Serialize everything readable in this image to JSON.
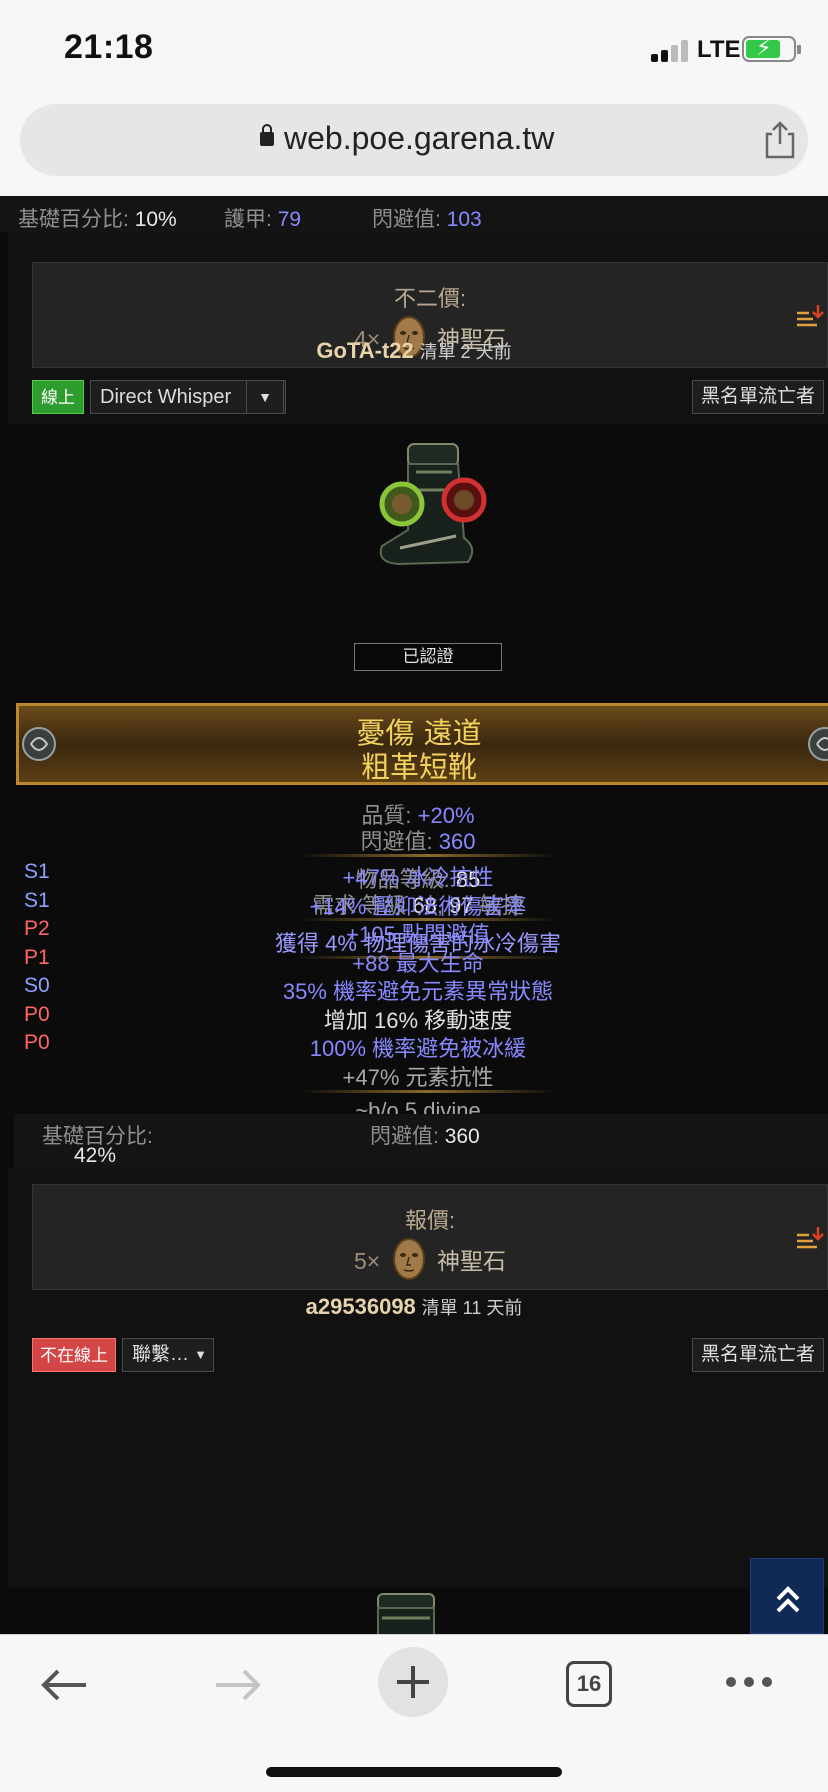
{
  "status_bar": {
    "time": "21:18",
    "network": "LTE",
    "battery_color": "#33c84a"
  },
  "browser": {
    "url": "web.poe.garena.tw",
    "tabs_count": "16"
  },
  "top_row": {
    "base_pct_label": "基礎百分比:",
    "base_pct_value": "10%",
    "armour_label": "護甲:",
    "armour_value": "79",
    "evasion_label": "閃避值:",
    "evasion_value": "103"
  },
  "listing1": {
    "price_label": "不二價:",
    "price_qty": "4×",
    "price_currency": "神聖石",
    "seller": "GoTA-t22",
    "listed": "清單 2 天前",
    "status": "線上",
    "whisper": "Direct Whisper",
    "blacklist": "黑名單流亡者"
  },
  "item": {
    "verified": "已認證",
    "name": "憂傷 遠道",
    "base": "粗革短靴",
    "quality_label": "品質:",
    "quality_value": "+20%",
    "evasion_label": "閃避值:",
    "evasion_value": "360",
    "ilvl_label": "物品等級:",
    "ilvl_value": "85",
    "req_prefix": "需求 等級",
    "req_level": "68",
    "req_sep": ",",
    "req_dex": "97",
    "req_suffix": "敏捷",
    "implicit": "獲得 4% 物理傷害的冰冷傷害",
    "mods": [
      {
        "tag": "S1",
        "text": "+47% 冰冷抗性"
      },
      {
        "tag": "S1",
        "text": "+14% 壓抑法術傷害率"
      },
      {
        "tag": "P2",
        "text": "+105 點閃避值"
      },
      {
        "tag": "P1",
        "text": "+88 最大生命"
      },
      {
        "tag": "S0",
        "text": "35% 機率避免元素異常狀態"
      },
      {
        "tag": "P0",
        "text": "增加 16% 移動速度"
      },
      {
        "tag": "P0",
        "text": "100% 機率避免被冰緩"
      }
    ],
    "pseudo": "+47% 元素抗性",
    "note": "~b/o 5 divine"
  },
  "bottom_row": {
    "base_pct_label": "基礎百分比:",
    "base_pct_value": "42%",
    "evasion_label": "閃避值:",
    "evasion_value": "360"
  },
  "listing2": {
    "price_label": "報價:",
    "price_qty": "5×",
    "price_currency": "神聖石",
    "seller": "a29536098",
    "listed": "清單 11 天前",
    "status": "不在線上",
    "contact": "聯繫…",
    "blacklist": "黑名單流亡者"
  },
  "colors": {
    "page_bg": "#0b0b0b",
    "unique_name": "#f2d25a",
    "mod_blue": "#8888ff",
    "online_green": "#2e9c2e",
    "offline_red": "#d44545"
  }
}
